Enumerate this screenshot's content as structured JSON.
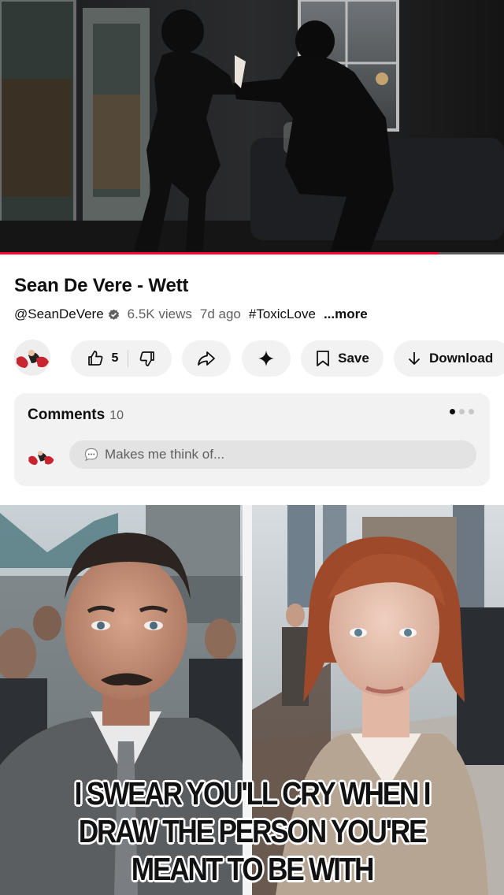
{
  "player": {
    "progress_fraction": 0.87,
    "accent_color": "#ff0033"
  },
  "video": {
    "title": "Sean De Vere - Wett",
    "channel": "@SeanDeVere",
    "verified_icon": "verified-badge-icon",
    "views": "6.5K views",
    "age": "7d ago",
    "hashtag": "#ToxicLove",
    "more_label": "...more"
  },
  "actions": {
    "like_count": "5",
    "like_icon": "thumbs-up-icon",
    "dislike_icon": "thumbs-down-icon",
    "share_icon": "share-arrow-icon",
    "ask_icon": "sparkle-icon",
    "save_label": "Save",
    "save_icon": "bookmark-icon",
    "download_label": "Download",
    "download_icon": "download-arrow-icon"
  },
  "comments": {
    "heading": "Comments",
    "count": "10",
    "placeholder": "Makes me think of...",
    "carousel_pages": 3,
    "carousel_active": 0
  },
  "next_video": {
    "caption_lines": [
      "I SWEAR YOU'LL CRY WHEN I",
      "DRAW THE PERSON YOU'RE",
      "MEANT TO BE WITH"
    ]
  }
}
